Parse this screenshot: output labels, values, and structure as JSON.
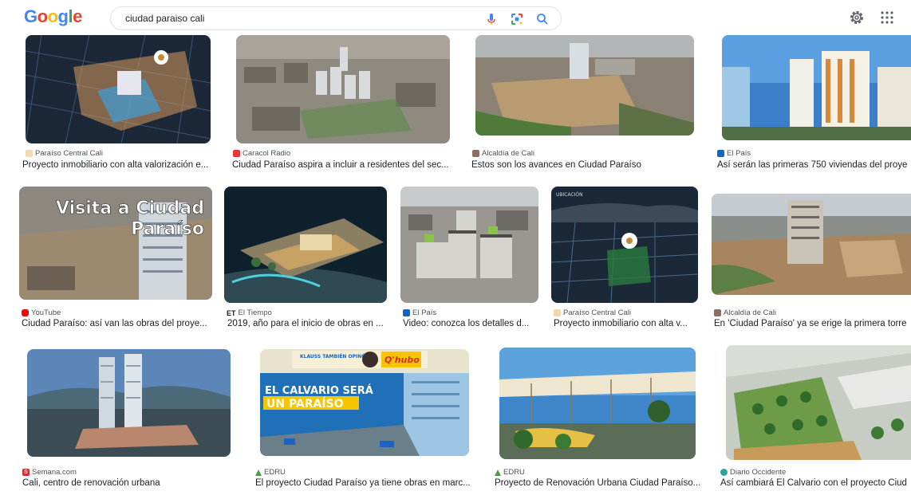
{
  "header": {
    "logo": "Google",
    "query": "ciudad paraiso cali"
  },
  "icons": {
    "mic": "microphone-icon",
    "lens": "lens-icon",
    "search": "search-icon",
    "settings": "gear-icon",
    "apps": "apps-grid-icon"
  },
  "colors": {
    "google_blue": "#4285F4",
    "google_red": "#EA4335",
    "google_yellow": "#FBBC05",
    "google_green": "#34A853",
    "caption": "#202124",
    "source": "#4d5156"
  },
  "results": [
    {
      "source": "Paraíso Central Cali",
      "title": "Proyecto inmobiliario con alta valorización e...",
      "fav": "#f2d7b3",
      "img": "night-aerial"
    },
    {
      "source": "Caracol Radio",
      "title": "Ciudad Paraíso aspira a incluir a residentes del sec...",
      "fav": "#e53935",
      "img": "aerial-city"
    },
    {
      "source": "Alcaldía de Cali",
      "title": "Estos son los avances en Ciudad Paraíso",
      "fav": "#8d6e63",
      "img": "aerial-site"
    },
    {
      "source": "El País",
      "title": "Así serán las primeras 750 viviendas del proye",
      "fav": "#1565c0",
      "img": "render-towers"
    },
    {
      "source": "YouTube",
      "title": "Ciudad Paraíso: así van las obras del proye...",
      "fav": "#ff0000",
      "img": "youtube-visit",
      "overlay_1": "Visita a Ciudad",
      "overlay_2": "Paraíso"
    },
    {
      "source": "El Tiempo",
      "title": "2019, año para el inicio de obras en ...",
      "fav": "#000000",
      "img": "night-render",
      "badge": "ET"
    },
    {
      "source": "El País",
      "title": "Video: conozca los detalles d...",
      "fav": "#1565c0",
      "img": "blocks-render"
    },
    {
      "source": "Paraíso Central Cali",
      "title": "Proyecto inmobiliario con alta v...",
      "fav": "#f2d7b3",
      "img": "night-map",
      "overlay_1": "UBICACIÓN"
    },
    {
      "source": "Alcaldía de Cali",
      "title": "En 'Ciudad Paraíso' ya se erige la primera torre",
      "fav": "#8d6e63",
      "img": "construction"
    },
    {
      "source": "Semana.com",
      "title": "Cali, centro de renovación urbana",
      "fav": "#d32f2f",
      "img": "twin-towers",
      "badge": "S"
    },
    {
      "source": "EDRU",
      "title": "El proyecto Ciudad Paraíso ya tiene obras en marc...",
      "fav": "#43a047",
      "img": "newspaper",
      "overlay_1": "EL CALVARIO SERÁ",
      "overlay_2": "UN PARAÍSO",
      "overlay_3": "KLAUSS TAMBIÉN OPINÓ",
      "overlay_4": "Q'hubo"
    },
    {
      "source": "EDRU",
      "title": "Proyecto de Renovación Urbana Ciudad Paraíso...",
      "fav": "#43a047",
      "img": "canopy"
    },
    {
      "source": "Diario Occidente",
      "title": "Así cambiará El Calvario con el proyecto Ciud",
      "fav": "#26a69a",
      "img": "green-roof"
    }
  ]
}
